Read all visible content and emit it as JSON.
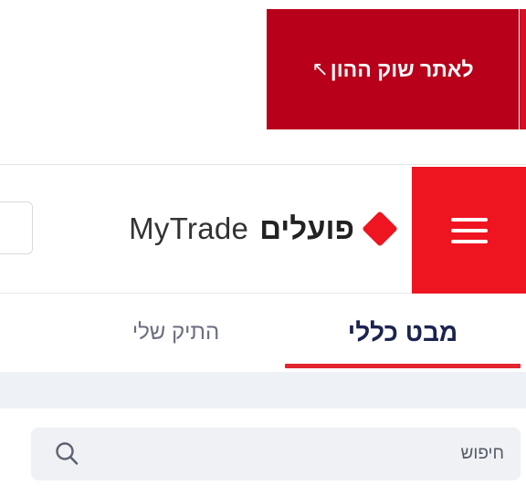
{
  "market_link": {
    "label": "לאתר שוק ההון",
    "arrow": "↖"
  },
  "header": {
    "brand_hebrew": "פועלים",
    "brand_english": "MyTrade",
    "menu_icon": "hamburger-icon",
    "logo_icon": "diamond-logo-icon"
  },
  "tabs": [
    {
      "label": "מבט כללי",
      "active": true
    },
    {
      "label": "התיק שלי",
      "active": false
    }
  ],
  "search": {
    "value": "",
    "placeholder": "חיפוש",
    "icon": "search-icon"
  },
  "colors": {
    "market_button": "#b8001a",
    "menu_button": "#ee1521",
    "brand_red": "#ee1521",
    "active_tab_text": "#1b2350",
    "tab_underline": "#e3252f",
    "search_background": "#eff1f5"
  }
}
